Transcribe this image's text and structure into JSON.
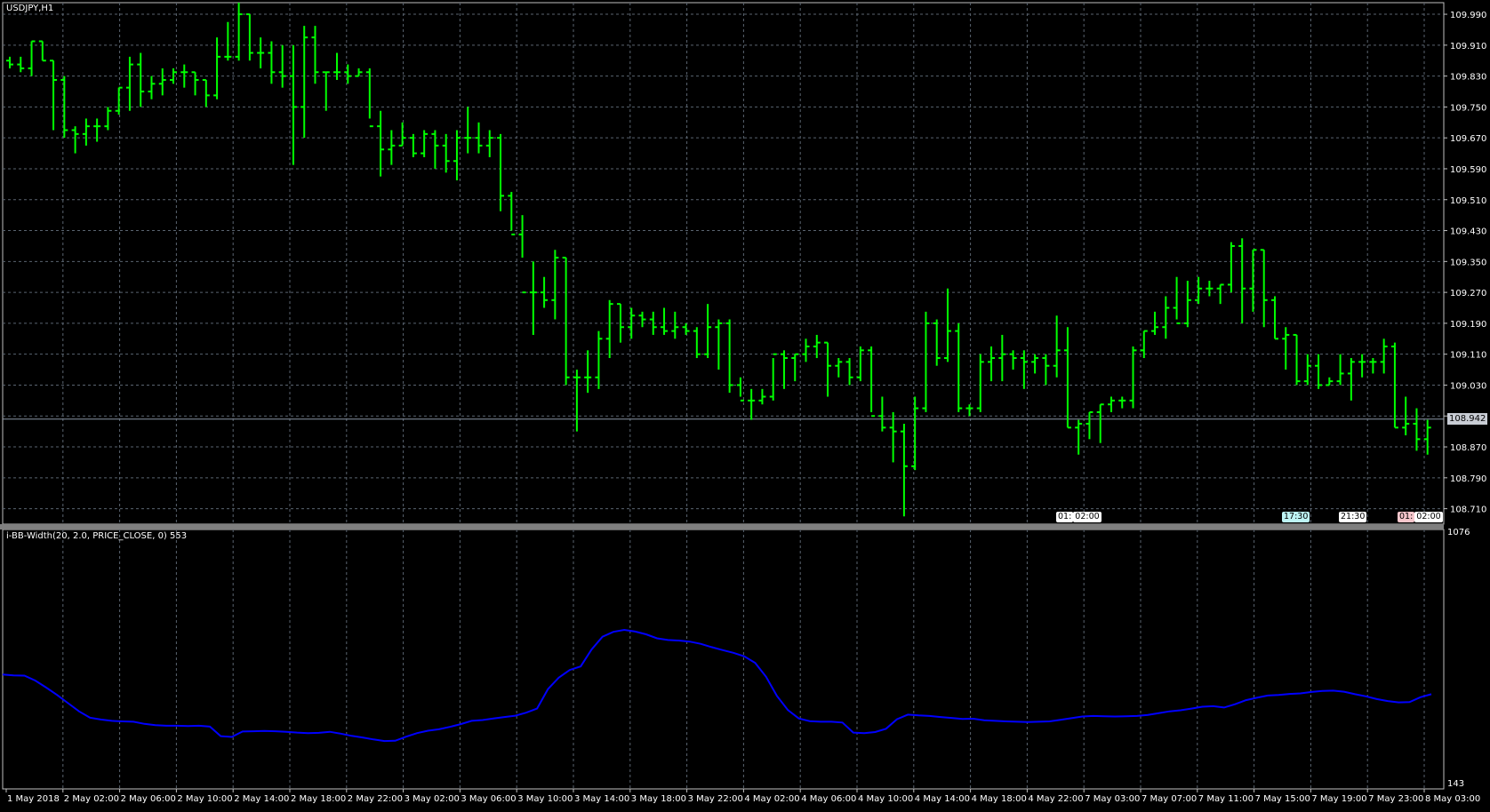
{
  "main_panel": {
    "symbol_label": "USDJPY,H1",
    "current_price": "108.942",
    "price_ticks": [
      "109.990",
      "109.910",
      "109.830",
      "109.750",
      "109.670",
      "109.590",
      "109.510",
      "109.430",
      "109.350",
      "109.270",
      "109.190",
      "109.110",
      "109.030",
      "108.950",
      "108.870",
      "108.790",
      "108.710"
    ],
    "events": [
      {
        "left": "01:",
        "right": "02:00",
        "left_bg": "#ffffff",
        "right_bg": "#ffffff"
      },
      {
        "left": "17:30",
        "right": "",
        "left_bg": "#bdf4f4",
        "right_bg": ""
      },
      {
        "left": "21:30",
        "right": "",
        "left_bg": "#ffffff",
        "right_bg": ""
      },
      {
        "left": "01:",
        "right": "02:00",
        "left_bg": "#f6c6cc",
        "right_bg": "#ffffff"
      }
    ]
  },
  "indicator_panel": {
    "label": "i-BB-Width(20, 2.0, PRICE_CLOSE, 0) 553",
    "scale_max": "1076",
    "scale_min": "143"
  },
  "time_axis": {
    "labels": [
      "1 May 2018",
      "2 May 02:00",
      "2 May 06:00",
      "2 May 10:00",
      "2 May 14:00",
      "2 May 18:00",
      "2 May 22:00",
      "3 May 02:00",
      "3 May 06:00",
      "3 May 10:00",
      "3 May 14:00",
      "3 May 18:00",
      "3 May 22:00",
      "4 May 02:00",
      "4 May 06:00",
      "4 May 10:00",
      "4 May 14:00",
      "4 May 18:00",
      "4 May 22:00",
      "7 May 03:00",
      "7 May 07:00",
      "7 May 11:00",
      "7 May 15:00",
      "7 May 19:00",
      "7 May 23:00",
      "8 May 03:00"
    ]
  },
  "colors": {
    "background": "#000000",
    "bars": "#00ff00",
    "indicator_line": "#0000ff",
    "grid": "#5a6470",
    "axis": "#c0c0c0"
  },
  "chart_data": [
    {
      "type": "ohlc",
      "title": "USDJPY,H1",
      "timeframe": "H1",
      "ylim": [
        108.67,
        110.02
      ],
      "grid": true,
      "bars": [
        [
          109.87,
          109.88,
          109.85,
          109.86
        ],
        [
          109.86,
          109.88,
          109.84,
          109.85
        ],
        [
          109.85,
          109.92,
          109.83,
          109.92
        ],
        [
          109.92,
          109.92,
          109.87,
          109.87
        ],
        [
          109.87,
          109.87,
          109.69,
          109.82
        ],
        [
          109.82,
          109.83,
          109.67,
          109.69
        ],
        [
          109.69,
          109.7,
          109.63,
          109.68
        ],
        [
          109.68,
          109.72,
          109.65,
          109.7
        ],
        [
          109.7,
          109.72,
          109.66,
          109.7
        ],
        [
          109.7,
          109.75,
          109.69,
          109.74
        ],
        [
          109.74,
          109.8,
          109.73,
          109.8
        ],
        [
          109.8,
          109.88,
          109.74,
          109.86
        ],
        [
          109.86,
          109.89,
          109.75,
          109.79
        ],
        [
          109.79,
          109.83,
          109.77,
          109.81
        ],
        [
          109.81,
          109.85,
          109.78,
          109.82
        ],
        [
          109.82,
          109.85,
          109.81,
          109.84
        ],
        [
          109.84,
          109.86,
          109.8,
          109.84
        ],
        [
          109.84,
          109.84,
          109.78,
          109.82
        ],
        [
          109.82,
          109.82,
          109.75,
          109.78
        ],
        [
          109.78,
          109.93,
          109.77,
          109.88
        ],
        [
          109.88,
          109.97,
          109.87,
          109.88
        ],
        [
          109.88,
          110.02,
          109.87,
          109.99
        ],
        [
          109.99,
          109.99,
          109.87,
          109.89
        ],
        [
          109.89,
          109.93,
          109.85,
          109.89
        ],
        [
          109.89,
          109.92,
          109.81,
          109.84
        ],
        [
          109.84,
          109.91,
          109.8,
          109.83
        ],
        [
          109.83,
          109.91,
          109.6,
          109.75
        ],
        [
          109.75,
          109.96,
          109.67,
          109.93
        ],
        [
          109.93,
          109.96,
          109.81,
          109.84
        ],
        [
          109.84,
          109.84,
          109.74,
          109.84
        ],
        [
          109.84,
          109.89,
          109.82,
          109.84
        ],
        [
          109.84,
          109.86,
          109.81,
          109.83
        ],
        [
          109.83,
          109.85,
          109.83,
          109.84
        ],
        [
          109.84,
          109.85,
          109.72,
          109.7
        ],
        [
          109.7,
          109.74,
          109.57,
          109.64
        ],
        [
          109.64,
          109.69,
          109.6,
          109.65
        ],
        [
          109.65,
          109.71,
          109.65,
          109.67
        ],
        [
          109.67,
          109.68,
          109.62,
          109.63
        ],
        [
          109.63,
          109.69,
          109.62,
          109.68
        ],
        [
          109.68,
          109.69,
          109.59,
          109.65
        ],
        [
          109.65,
          109.68,
          109.58,
          109.61
        ],
        [
          109.61,
          109.69,
          109.56,
          109.67
        ],
        [
          109.67,
          109.75,
          109.63,
          109.67
        ],
        [
          109.67,
          109.71,
          109.63,
          109.65
        ],
        [
          109.65,
          109.69,
          109.62,
          109.67
        ],
        [
          109.67,
          109.68,
          109.48,
          109.52
        ],
        [
          109.52,
          109.53,
          109.43,
          109.42
        ],
        [
          109.42,
          109.47,
          109.36,
          109.27
        ],
        [
          109.27,
          109.35,
          109.16,
          109.27
        ],
        [
          109.27,
          109.31,
          109.23,
          109.25
        ],
        [
          109.25,
          109.38,
          109.2,
          109.36
        ],
        [
          109.36,
          109.36,
          109.03,
          109.05
        ],
        [
          109.05,
          109.07,
          108.91,
          109.05
        ],
        [
          109.05,
          109.12,
          109.01,
          109.05
        ],
        [
          109.05,
          109.17,
          109.02,
          109.15
        ],
        [
          109.15,
          109.25,
          109.1,
          109.24
        ],
        [
          109.24,
          109.24,
          109.14,
          109.18
        ],
        [
          109.18,
          109.23,
          109.15,
          109.21
        ],
        [
          109.21,
          109.22,
          109.18,
          109.2
        ],
        [
          109.2,
          109.22,
          109.16,
          109.18
        ],
        [
          109.18,
          109.23,
          109.16,
          109.17
        ],
        [
          109.17,
          109.22,
          109.15,
          109.18
        ],
        [
          109.18,
          109.19,
          109.16,
          109.17
        ],
        [
          109.17,
          109.18,
          109.1,
          109.11
        ],
        [
          109.11,
          109.24,
          109.1,
          109.18
        ],
        [
          109.18,
          109.2,
          109.07,
          109.19
        ],
        [
          109.19,
          109.2,
          109.01,
          109.03
        ],
        [
          109.03,
          109.05,
          109.0,
          108.99
        ],
        [
          108.99,
          109.02,
          108.94,
          108.99
        ],
        [
          108.99,
          109.02,
          108.98,
          109.0
        ],
        [
          109.0,
          109.1,
          108.99,
          109.11
        ],
        [
          109.11,
          109.12,
          109.02,
          109.1
        ],
        [
          109.1,
          109.11,
          109.04,
          109.11
        ],
        [
          109.11,
          109.15,
          109.09,
          109.13
        ],
        [
          109.13,
          109.16,
          109.1,
          109.14
        ],
        [
          109.14,
          109.14,
          109.0,
          109.08
        ],
        [
          109.08,
          109.1,
          109.05,
          109.09
        ],
        [
          109.09,
          109.1,
          109.03,
          109.05
        ],
        [
          109.05,
          109.13,
          109.04,
          109.12
        ],
        [
          109.12,
          109.13,
          108.96,
          108.95
        ],
        [
          108.95,
          109.0,
          108.91,
          108.92
        ],
        [
          108.92,
          108.96,
          108.83,
          108.91
        ],
        [
          108.91,
          108.93,
          108.69,
          108.82
        ],
        [
          108.82,
          109.0,
          108.81,
          108.97
        ],
        [
          108.97,
          109.22,
          108.96,
          109.19
        ],
        [
          109.19,
          109.2,
          109.08,
          109.1
        ],
        [
          109.1,
          109.28,
          109.09,
          109.17
        ],
        [
          109.17,
          109.19,
          108.96,
          108.97
        ],
        [
          108.97,
          108.98,
          108.95,
          108.97
        ],
        [
          108.97,
          109.11,
          108.96,
          109.09
        ],
        [
          109.09,
          109.13,
          109.04,
          109.1
        ],
        [
          109.1,
          109.16,
          109.04,
          109.11
        ],
        [
          109.11,
          109.12,
          109.07,
          109.1
        ],
        [
          109.1,
          109.12,
          109.02,
          109.09
        ],
        [
          109.09,
          109.11,
          109.06,
          109.1
        ],
        [
          109.1,
          109.11,
          109.03,
          109.08
        ],
        [
          109.08,
          109.21,
          109.05,
          109.12
        ],
        [
          109.12,
          109.18,
          108.92,
          108.92
        ],
        [
          108.92,
          108.94,
          108.85,
          108.93
        ],
        [
          108.93,
          108.96,
          108.89,
          108.96
        ],
        [
          108.96,
          108.98,
          108.88,
          108.98
        ],
        [
          108.98,
          109.0,
          108.96,
          108.99
        ],
        [
          108.99,
          109.0,
          108.97,
          108.99
        ],
        [
          108.99,
          109.13,
          108.97,
          109.12
        ],
        [
          109.12,
          109.17,
          109.1,
          109.17
        ],
        [
          109.17,
          109.22,
          109.16,
          109.18
        ],
        [
          109.18,
          109.26,
          109.15,
          109.23
        ],
        [
          109.23,
          109.31,
          109.2,
          109.19
        ],
        [
          109.19,
          109.3,
          109.18,
          109.25
        ],
        [
          109.25,
          109.31,
          109.24,
          109.28
        ],
        [
          109.28,
          109.3,
          109.26,
          109.28
        ],
        [
          109.28,
          109.29,
          109.24,
          109.29
        ],
        [
          109.29,
          109.4,
          109.27,
          109.39
        ],
        [
          109.39,
          109.41,
          109.19,
          109.28
        ],
        [
          109.28,
          109.38,
          109.22,
          109.38
        ],
        [
          109.38,
          109.38,
          109.18,
          109.25
        ],
        [
          109.25,
          109.26,
          109.15,
          109.15
        ],
        [
          109.15,
          109.18,
          109.07,
          109.16
        ],
        [
          109.16,
          109.16,
          109.03,
          109.04
        ],
        [
          109.04,
          109.11,
          109.03,
          109.08
        ],
        [
          109.08,
          109.11,
          109.02,
          109.03
        ],
        [
          109.03,
          109.05,
          109.03,
          109.04
        ],
        [
          109.04,
          109.11,
          109.03,
          109.06
        ],
        [
          109.06,
          109.1,
          108.99,
          109.09
        ],
        [
          109.09,
          109.11,
          109.05,
          109.09
        ],
        [
          109.09,
          109.1,
          109.06,
          109.09
        ],
        [
          109.09,
          109.15,
          109.06,
          109.13
        ],
        [
          109.13,
          109.14,
          108.92,
          108.92
        ],
        [
          108.92,
          109.0,
          108.9,
          108.93
        ],
        [
          108.93,
          108.97,
          108.86,
          108.89
        ],
        [
          108.89,
          108.94,
          108.85,
          108.92
        ]
      ],
      "bar_format": "open, high, low, close",
      "current_price": 108.942
    },
    {
      "type": "line",
      "title": "i-BB-Width(20, 2.0, PRICE_CLOSE, 0) 553",
      "ylim": [
        143,
        1076
      ],
      "series": [
        {
          "name": "i-BB-Width(20, 2.0, PRICE_CLOSE, 0)",
          "values": [
            553,
            550,
            549,
            531,
            505,
            478,
            448,
            418,
            395,
            388,
            383,
            381,
            380,
            372,
            367,
            365,
            365,
            364,
            365,
            362,
            327,
            324,
            344,
            345,
            346,
            345,
            343,
            340,
            338,
            339,
            343,
            336,
            328,
            322,
            315,
            309,
            310,
            325,
            338,
            347,
            352,
            361,
            371,
            383,
            386,
            392,
            397,
            402,
            413,
            428,
            500,
            542,
            570,
            583,
            645,
            692,
            710,
            717,
            711,
            701,
            686,
            680,
            678,
            674,
            666,
            654,
            643,
            633,
            620,
            596,
            545,
            474,
            423,
            392,
            382,
            380,
            380,
            377,
            340,
            338,
            342,
            354,
            389,
            406,
            403,
            401,
            397,
            394,
            390,
            391,
            385,
            383,
            381,
            380,
            379,
            380,
            381,
            387,
            393,
            399,
            401,
            400,
            399,
            400,
            401,
            405,
            411,
            418,
            422,
            428,
            435,
            437,
            432,
            444,
            459,
            468,
            476,
            478,
            482,
            484,
            489,
            493,
            494,
            490,
            481,
            473,
            463,
            456,
            451,
            452,
            470,
            481
          ]
        }
      ]
    }
  ]
}
